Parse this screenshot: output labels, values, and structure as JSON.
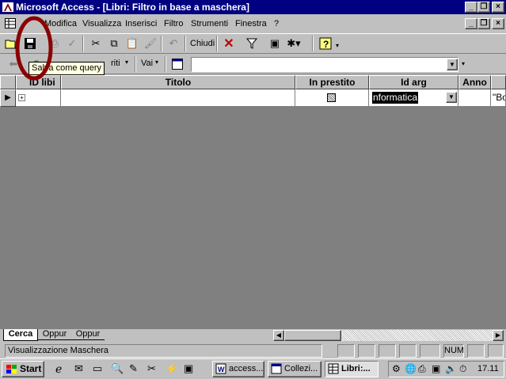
{
  "window": {
    "title": "Microsoft Access - [Libri: Filtro in base a maschera]"
  },
  "menu": {
    "items": [
      "Modifica",
      "Visualizza",
      "Inserisci",
      "Filtro",
      "Strumenti",
      "Finestra",
      "?"
    ]
  },
  "toolbar": {
    "close_label": "Chiudi",
    "tooltip": "Salva come query"
  },
  "toolbar2": {
    "criteria_label": "riti",
    "go_label": "Vai"
  },
  "grid": {
    "columns": [
      "ID libi",
      "Titolo",
      "In prestito",
      "Id arg",
      "Anno"
    ],
    "row": {
      "id_arg": "nformatica",
      "anno_tail": "\"Bo"
    }
  },
  "tabs": [
    "Cerca",
    "Oppur",
    "Oppur"
  ],
  "status": {
    "text": "Visualizzazione Maschera",
    "num": "NUM"
  },
  "taskbar": {
    "start": "Start",
    "tasks": [
      "access...",
      "Collezi...",
      "Libri:..."
    ],
    "clock": "17.11"
  }
}
